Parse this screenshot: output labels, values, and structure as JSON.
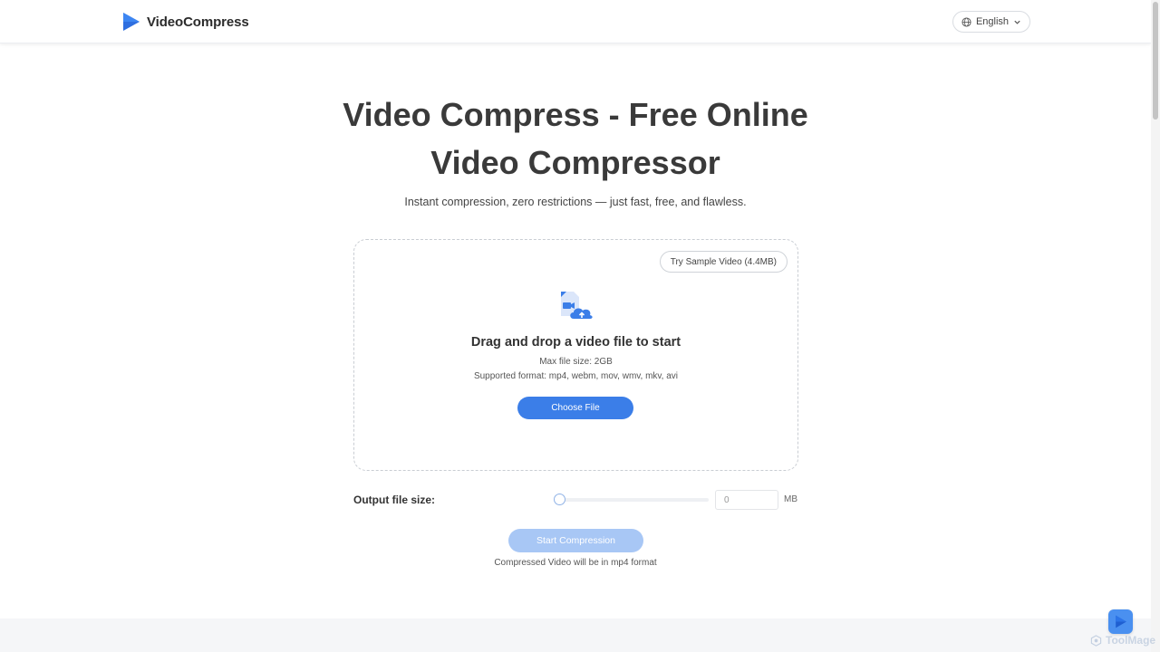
{
  "header": {
    "brand": "VideoCompress",
    "language": "English"
  },
  "hero": {
    "title_line1": "Video Compress - Free Online",
    "title_line2": "Video Compressor",
    "subtitle": "Instant compression, zero restrictions — just fast, free, and flawless."
  },
  "dropzone": {
    "sample_button": "Try Sample Video (4.4MB)",
    "title": "Drag and drop a video file to start",
    "max_size": "Max file size: 2GB",
    "formats": "Supported format: mp4, webm, mov, wmv, mkv, avi",
    "choose_button": "Choose File"
  },
  "output": {
    "label": "Output file size:",
    "value": "0",
    "unit": "MB",
    "slider_level": 0
  },
  "actions": {
    "start_button": "Start Compression",
    "note": "Compressed Video will be in mp4 format"
  },
  "watermark": {
    "text": "ToolMage"
  },
  "colors": {
    "brand_blue": "#3b7ee8",
    "disabled_blue": "#a8c7f5"
  }
}
